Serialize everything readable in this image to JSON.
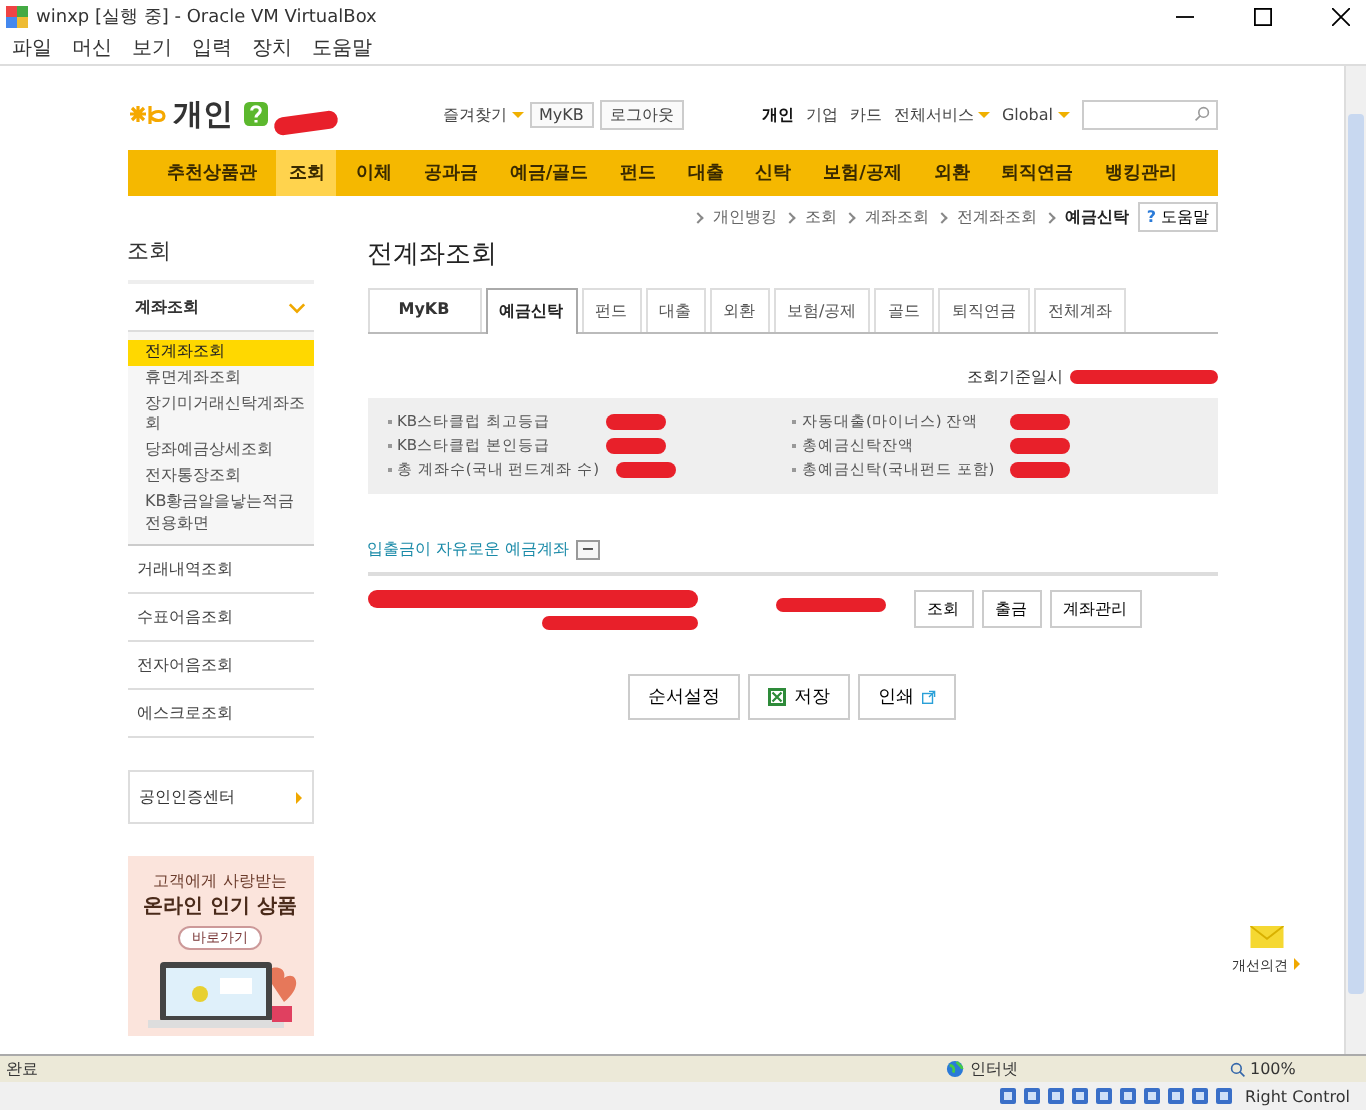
{
  "window": {
    "title": "winxp [실행 중] - Oracle VM VirtualBox"
  },
  "menu": [
    "파일",
    "머신",
    "보기",
    "입력",
    "장치",
    "도움말"
  ],
  "header": {
    "section": "개인",
    "favorites": "즐겨찾기",
    "buttons": [
      "MyKB",
      "로그아웃"
    ],
    "links": [
      {
        "label": "개인",
        "selected": true,
        "dropdown": false
      },
      {
        "label": "기업",
        "selected": false,
        "dropdown": false
      },
      {
        "label": "카드",
        "selected": false,
        "dropdown": false
      },
      {
        "label": "전체서비스",
        "selected": false,
        "dropdown": true
      },
      {
        "label": "Global",
        "selected": false,
        "dropdown": true
      }
    ]
  },
  "nav": [
    {
      "label": "추천상품관",
      "selected": false
    },
    {
      "label": "조회",
      "selected": true
    },
    {
      "label": "이체",
      "selected": false
    },
    {
      "label": "공과금",
      "selected": false
    },
    {
      "label": "예금/골드",
      "selected": false
    },
    {
      "label": "펀드",
      "selected": false
    },
    {
      "label": "대출",
      "selected": false
    },
    {
      "label": "신탁",
      "selected": false
    },
    {
      "label": "보험/공제",
      "selected": false
    },
    {
      "label": "외환",
      "selected": false
    },
    {
      "label": "퇴직연금",
      "selected": false
    },
    {
      "label": "뱅킹관리",
      "selected": false
    }
  ],
  "breadcrumb": [
    "개인뱅킹",
    "조회",
    "계좌조회",
    "전계좌조회",
    "예금신탁"
  ],
  "help_button": {
    "mark": "?",
    "label": "도움말"
  },
  "sidebar": {
    "title": "조회",
    "group": {
      "label": "계좌조회",
      "expanded": true,
      "items": [
        {
          "label": "전계좌조회",
          "selected": true
        },
        {
          "label": "휴면계좌조회",
          "selected": false
        },
        {
          "label": "장기미거래신탁계좌조회",
          "selected": false
        },
        {
          "label": "당좌예금상세조회",
          "selected": false
        },
        {
          "label": "전자통장조회",
          "selected": false
        },
        {
          "label": "KB황금알을낳는적금전용화면",
          "selected": false
        }
      ]
    },
    "links": [
      "거래내역조회",
      "수표어음조회",
      "전자어음조회",
      "에스크로조회"
    ],
    "cert_link": "공인인증센터",
    "banner": {
      "line1": "고객에게 사랑받는",
      "line2": "온라인 인기 상품",
      "button": "바로가기"
    }
  },
  "page": {
    "title": "전계좌조회",
    "tabs": [
      {
        "label": "MyKB",
        "selected": false
      },
      {
        "label": "예금신탁",
        "selected": true
      },
      {
        "label": "펀드",
        "selected": false
      },
      {
        "label": "대출",
        "selected": false
      },
      {
        "label": "외환",
        "selected": false
      },
      {
        "label": "보험/공제",
        "selected": false
      },
      {
        "label": "골드",
        "selected": false
      },
      {
        "label": "퇴직연금",
        "selected": false
      },
      {
        "label": "전체계좌",
        "selected": false
      }
    ],
    "as_of_label": "조회기준일시",
    "summary": [
      "KB스타클럽 최고등급",
      "자동대출(마이너스) 잔액",
      "KB스타클럽 본인등급",
      "총예금신탁잔액",
      "총 계좌수(국내 펀드계좌 수)",
      "총예금신탁(국내펀드 포함)"
    ],
    "section": {
      "title": "입출금이 자유로운 예금계좌",
      "toggle": "−"
    },
    "account_actions": [
      "조회",
      "출금",
      "계좌관리"
    ],
    "bottom_buttons": [
      {
        "label": "순서설정",
        "kind": "plain"
      },
      {
        "label": "저장",
        "kind": "excel"
      },
      {
        "label": "인쇄",
        "kind": "popup"
      }
    ]
  },
  "feedback": "개선의견",
  "status_bar": {
    "text": "완료",
    "zone": "인터넷",
    "zoom": "100%"
  },
  "host_key": "Right Control"
}
